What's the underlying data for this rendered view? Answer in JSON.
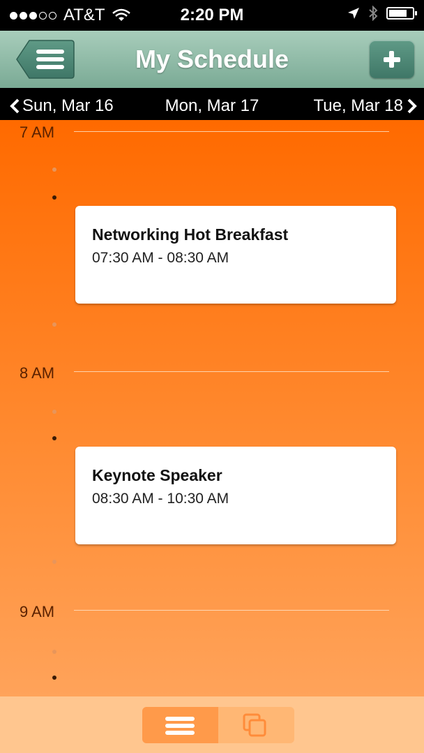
{
  "status_bar": {
    "carrier": "AT&T",
    "time": "2:20 PM"
  },
  "header": {
    "title": "My Schedule"
  },
  "date_nav": {
    "prev": "Sun, Mar 16",
    "current": "Mon, Mar 17",
    "next": "Tue, Mar 18"
  },
  "timeline": {
    "hours": [
      "7 AM",
      "8 AM",
      "9 AM"
    ]
  },
  "events": [
    {
      "title": "Networking Hot Breakfast",
      "time": "07:30 AM - 08:30 AM"
    },
    {
      "title": "Keynote Speaker",
      "time": "08:30 AM - 10:30 AM"
    }
  ],
  "colors": {
    "nav_teal": "#8fbca8",
    "schedule_orange": "#ff6a00",
    "tab_bar": "#ffc68f"
  },
  "tabbar": {
    "items": [
      "list-icon",
      "copy-icon"
    ]
  }
}
